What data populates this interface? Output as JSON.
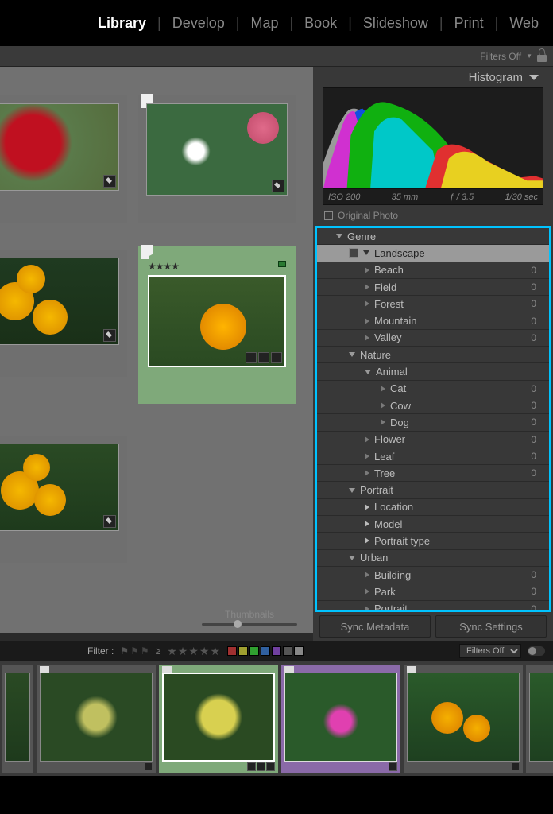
{
  "modules": {
    "library": "Library",
    "develop": "Develop",
    "map": "Map",
    "book": "Book",
    "slideshow": "Slideshow",
    "print": "Print",
    "web": "Web"
  },
  "filters_off": "Filters Off",
  "histogram_label": "Histogram",
  "hist": {
    "iso": "ISO 200",
    "focal": "35 mm",
    "aperture": "ƒ / 3.5",
    "shutter": "1/30 sec"
  },
  "original_photo": "Original Photo",
  "keywords": {
    "genre": "Genre",
    "landscape": "Landscape",
    "beach": "Beach",
    "field": "Field",
    "forest": "Forest",
    "mountain": "Mountain",
    "valley": "Valley",
    "nature": "Nature",
    "animal": "Animal",
    "cat": "Cat",
    "cow": "Cow",
    "dog": "Dog",
    "flower": "Flower",
    "leaf": "Leaf",
    "tree": "Tree",
    "portrait": "Portrait",
    "location": "Location",
    "model": "Model",
    "portrait_type": "Portrait type",
    "urban": "Urban",
    "building": "Building",
    "park": "Park",
    "portrait2": "Portrait"
  },
  "count_zero": "0",
  "sync_metadata": "Sync Metadata",
  "sync_settings": "Sync Settings",
  "thumbnails_label": "Thumbnails",
  "filter_label": "Filter :",
  "filters_off_dd": "Filters Off",
  "ge": "≥"
}
